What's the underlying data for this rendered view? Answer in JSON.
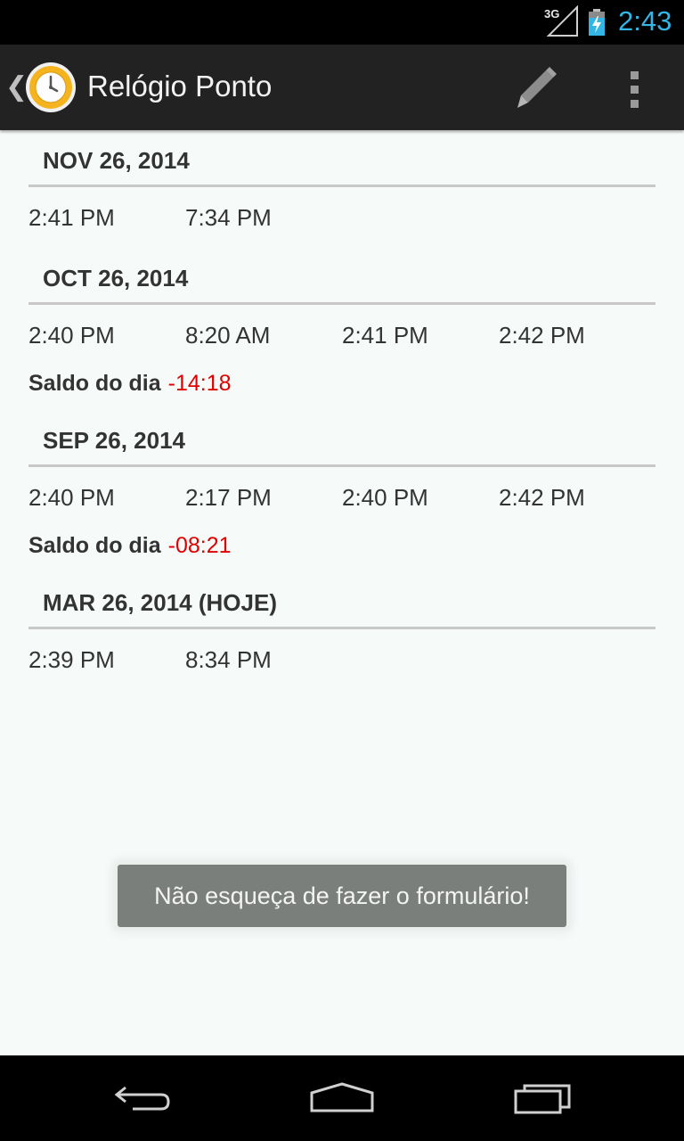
{
  "status_bar": {
    "network_type": "3G",
    "time": "2:43",
    "icons": [
      "signal-icon",
      "battery-charging-icon"
    ]
  },
  "action_bar": {
    "title": "Relógio Ponto",
    "icons": [
      "up-caret-icon",
      "clock-app-icon",
      "edit-pencil-icon",
      "overflow-menu-icon"
    ]
  },
  "days": [
    {
      "date": "NOV 26, 2014",
      "punches": [
        "2:41 PM",
        "7:34 PM"
      ]
    },
    {
      "date": "OCT 26, 2014",
      "punches": [
        "2:40 PM",
        "8:20 AM",
        "2:41 PM",
        "2:42 PM"
      ],
      "saldo_label": "Saldo do dia",
      "saldo_value": "-14:18"
    },
    {
      "date": "SEP 26, 2014",
      "punches": [
        "2:40 PM",
        "2:17 PM",
        "2:40 PM",
        "2:42 PM"
      ],
      "saldo_label": "Saldo do dia",
      "saldo_value": "-08:21"
    },
    {
      "date": "MAR 26, 2014 (HOJE)",
      "punches": [
        "2:39 PM",
        "8:34 PM"
      ]
    }
  ],
  "toast": {
    "message": "Não esqueça de fazer o formulário!"
  },
  "colors": {
    "accent_clock": "#33b5e5",
    "negative_balance": "#e00000",
    "action_bar": "#222222"
  },
  "nav_bar": {
    "icons": [
      "back-icon",
      "home-icon",
      "recents-icon"
    ]
  }
}
